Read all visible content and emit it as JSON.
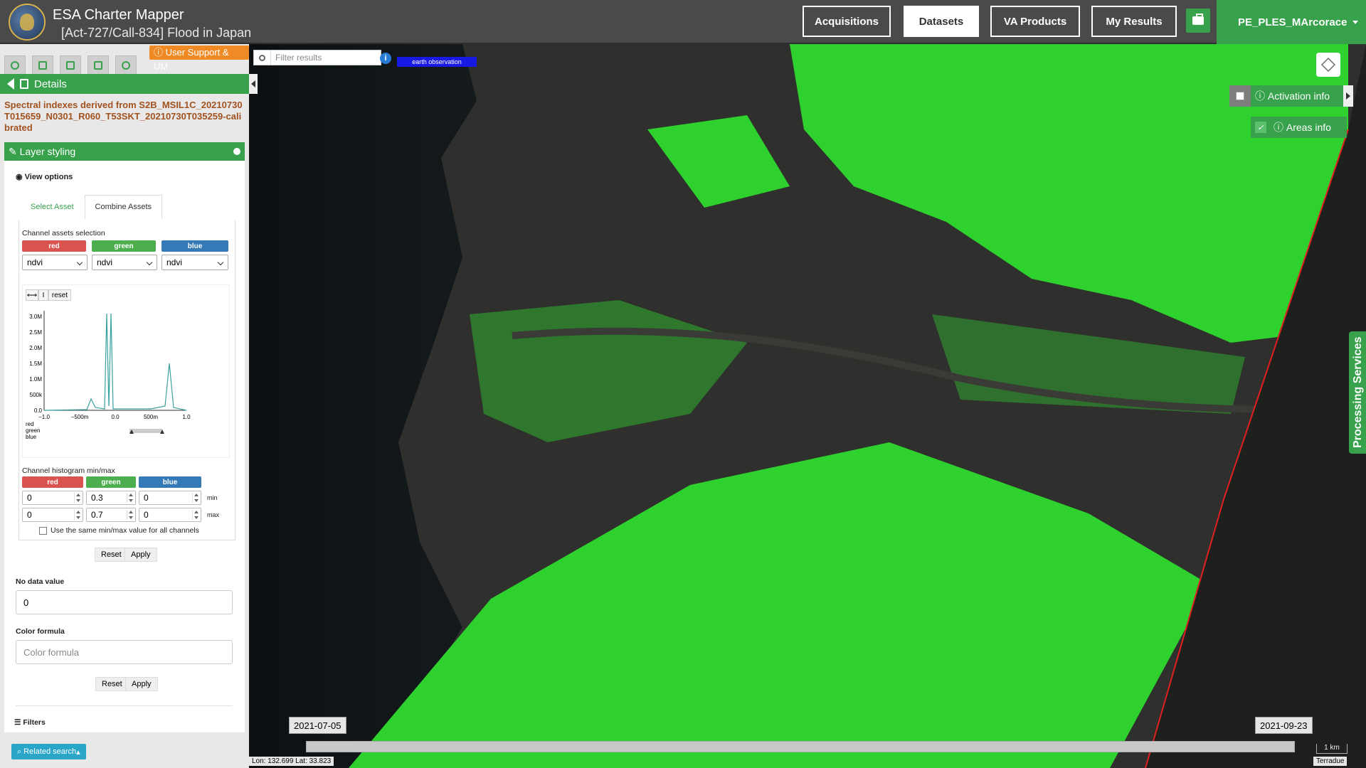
{
  "app": {
    "title": "ESA Charter Mapper",
    "subtitle": "[Act-727/Call-834] Flood in Japan"
  },
  "nav": {
    "acquisitions": "Acquisitions",
    "datasets": "Datasets",
    "va_products": "VA Products",
    "my_results": "My Results",
    "user": "PE_PLES_MArcorace"
  },
  "left": {
    "support_label": "User Support & UM",
    "details_label": "Details",
    "product_title": "Spectral indexes derived from S2B_MSIL1C_20210730T015659_N0301_R060_T53SKT_20210730T035259-calibrated",
    "layer_styling": "Layer styling",
    "view_options": "View options",
    "tabs": [
      "Select Asset",
      "Combine Assets"
    ],
    "channel_assets_label": "Channel assets selection",
    "channels": [
      "red",
      "green",
      "blue"
    ],
    "channel_values": [
      "ndvi",
      "ndvi",
      "ndvi"
    ],
    "hist_reset": "reset",
    "hist_pan": "⟷",
    "hist_cursor": "I",
    "y_ticks": [
      "3.0M",
      "2.5M",
      "2.0M",
      "1.5M",
      "1.0M",
      "500k",
      "0.0"
    ],
    "x_ticks": [
      "−1.0",
      "−500m",
      "0.0",
      "500m",
      "1.0"
    ],
    "legend": [
      "red",
      "green",
      "blue"
    ],
    "minmax_label": "Channel histogram min/max",
    "min_values": [
      "0",
      "0.3",
      "0"
    ],
    "max_values": [
      "0",
      "0.7",
      "0"
    ],
    "min_label": "min",
    "max_label": "max",
    "same_minmax": "Use the same min/max value for all channels",
    "reset": "Reset",
    "apply": "Apply",
    "no_data_label": "No data value",
    "no_data_value": "0",
    "color_formula_label": "Color formula",
    "color_formula_placeholder": "Color formula",
    "filters_label": "Filters",
    "related_search": "Related search"
  },
  "map": {
    "filter_placeholder": "Filter results",
    "eo_badge": "earth observation",
    "activation_info": "Activation info",
    "areas_info": "Areas info",
    "processing_services": "Processing Services",
    "date_start": "2021-07-05",
    "date_end": "2021-09-23",
    "scale": "1 km",
    "coords": "Lon: 132.699 Lat: 33.823",
    "attribution": "Terradue"
  },
  "colors": {
    "accent": "#37a24b",
    "topbar": "#4a4a4a",
    "vegetation": "#2fd12f",
    "swath": "#e02020"
  }
}
